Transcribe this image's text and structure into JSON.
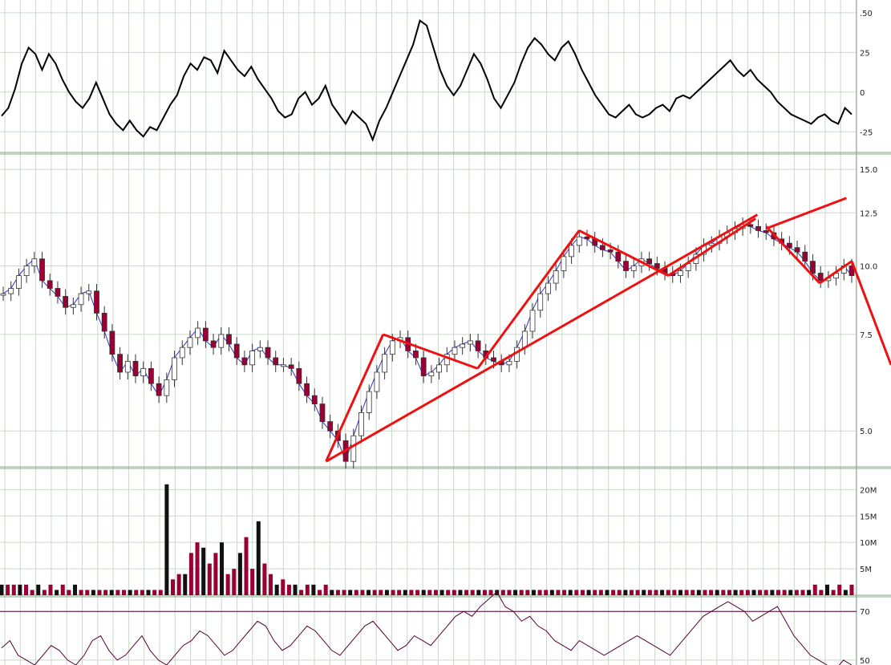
{
  "chart_data": {
    "type": "line",
    "title": "",
    "colors": {
      "background": "#ffffff",
      "grid": "#c9d8c9",
      "panel_border": "#8aa58a",
      "price_up": "#ffffff",
      "price_down": "#990033",
      "trendline": "#ee1111",
      "oscillator": "#000000",
      "rsi_line": "#550033",
      "rsi_fill": "#c8c898"
    },
    "panels": [
      {
        "id": "oscillator",
        "axis_ticks": [
          ".50",
          "25",
          "0",
          "-25"
        ],
        "tick_values": [
          50,
          25,
          0,
          -25
        ],
        "ylim": [
          -38,
          58
        ]
      },
      {
        "id": "price",
        "scale": "log",
        "axis_ticks": [
          "15.0",
          "12.5",
          "10.0",
          "7.5",
          "5.0"
        ],
        "tick_values": [
          15.0,
          12.5,
          10.0,
          7.5,
          5.0
        ],
        "ylim": [
          4.3,
          16.0
        ]
      },
      {
        "id": "volume",
        "axis_ticks": [
          "20M",
          "15M",
          "10M",
          "5M"
        ],
        "tick_values": [
          20,
          15,
          10,
          5
        ],
        "ylim": [
          0,
          24
        ]
      },
      {
        "id": "rsi",
        "axis_ticks": [
          "70",
          "50"
        ],
        "tick_values": [
          70,
          50
        ],
        "ylim": [
          48,
          76
        ]
      }
    ],
    "oscillator_values": [
      -15,
      -10,
      2,
      18,
      28,
      24,
      14,
      24,
      18,
      8,
      0,
      -6,
      -10,
      -4,
      6,
      -4,
      -14,
      -20,
      -24,
      -18,
      -24,
      -28,
      -22,
      -24,
      -16,
      -8,
      -2,
      10,
      18,
      14,
      22,
      20,
      12,
      26,
      20,
      14,
      10,
      16,
      8,
      2,
      -4,
      -12,
      -16,
      -14,
      -4,
      0,
      -8,
      -4,
      4,
      -8,
      -14,
      -20,
      -12,
      -16,
      -20,
      -30,
      -18,
      -10,
      0,
      10,
      20,
      30,
      45,
      42,
      28,
      14,
      4,
      -2,
      4,
      14,
      24,
      18,
      8,
      -4,
      -10,
      -2,
      6,
      18,
      28,
      34,
      30,
      24,
      20,
      28,
      32,
      24,
      14,
      6,
      -2,
      -8,
      -14,
      -16,
      -12,
      -8,
      -14,
      -16,
      -14,
      -10,
      -8,
      -12,
      -4,
      -2,
      -4,
      0,
      4,
      8,
      12,
      16,
      20,
      14,
      10,
      14,
      8,
      4,
      0,
      -6,
      -10,
      -14,
      -16,
      -18,
      -20,
      -16,
      -14,
      -18,
      -20,
      -10,
      -14
    ],
    "price": {
      "closes": [
        8.9,
        9.1,
        9.6,
        10.0,
        10.3,
        9.4,
        9.1,
        8.8,
        8.4,
        8.5,
        8.9,
        9.0,
        8.2,
        7.6,
        6.9,
        6.4,
        6.7,
        6.3,
        6.5,
        6.1,
        5.8,
        6.2,
        6.8,
        7.1,
        7.4,
        7.7,
        7.3,
        7.1,
        7.5,
        7.2,
        6.8,
        6.6,
        7.0,
        7.1,
        6.8,
        6.6,
        6.6,
        6.5,
        6.1,
        5.8,
        5.6,
        5.2,
        5.0,
        4.8,
        4.4,
        4.9,
        5.4,
        5.9,
        6.4,
        6.9,
        7.3,
        7.4,
        7.0,
        6.8,
        6.3,
        6.4,
        6.6,
        6.9,
        7.1,
        7.2,
        7.3,
        7.0,
        6.8,
        6.7,
        6.6,
        6.7,
        7.1,
        7.6,
        8.3,
        8.9,
        9.3,
        9.8,
        10.4,
        10.9,
        11.3,
        11.2,
        10.9,
        10.7,
        10.6,
        10.2,
        9.8,
        10.0,
        10.3,
        10.1,
        9.9,
        9.7,
        9.6,
        9.8,
        10.1,
        10.5,
        10.9,
        11.0,
        11.3,
        11.5,
        11.7,
        11.9,
        11.8,
        11.6,
        11.5,
        11.2,
        11.0,
        10.8,
        10.6,
        10.2,
        9.7,
        9.4,
        9.5,
        9.7,
        10.0,
        9.6
      ],
      "trendlines": [
        {
          "label": "wave-1-up",
          "points": [
            [
              0.366,
              4.4
            ],
            [
              0.43,
              7.5
            ]
          ]
        },
        {
          "label": "wave-2-down",
          "points": [
            [
              0.43,
              7.5
            ],
            [
              0.536,
              6.5
            ]
          ]
        },
        {
          "label": "wave-3-up",
          "points": [
            [
              0.536,
              6.5
            ],
            [
              0.65,
              11.6
            ]
          ]
        },
        {
          "label": "wave-4-down",
          "points": [
            [
              0.65,
              11.6
            ],
            [
              0.75,
              9.6
            ]
          ]
        },
        {
          "label": "wave-5-up",
          "points": [
            [
              0.75,
              9.6
            ],
            [
              0.848,
              12.2
            ]
          ]
        },
        {
          "label": "base-trendline",
          "points": [
            [
              0.366,
              4.4
            ],
            [
              0.85,
              12.4
            ]
          ]
        },
        {
          "label": "upper-channel",
          "points": [
            [
              0.86,
              11.7
            ],
            [
              0.95,
              13.3
            ]
          ]
        },
        {
          "label": "drop-a",
          "points": [
            [
              0.86,
              11.8
            ],
            [
              0.92,
              9.3
            ]
          ]
        },
        {
          "label": "drop-b",
          "points": [
            [
              0.92,
              9.3
            ],
            [
              0.956,
              10.2
            ]
          ]
        },
        {
          "label": "drop-c",
          "points": [
            [
              0.956,
              10.2
            ],
            [
              1.0,
              6.6
            ]
          ]
        }
      ]
    },
    "volume_values": [
      2,
      2,
      2,
      2,
      2,
      1,
      2,
      1,
      2,
      1,
      2,
      1,
      2,
      1,
      1,
      1,
      1,
      1,
      1,
      1,
      1,
      1,
      1,
      1,
      1,
      1,
      1,
      21,
      3,
      4,
      4,
      8,
      10,
      9,
      6,
      8,
      10,
      4,
      5,
      8,
      11,
      5,
      14,
      6,
      4,
      2,
      3,
      2,
      2,
      1,
      2,
      2,
      1,
      2,
      1,
      1,
      1,
      1,
      1,
      1,
      1,
      1,
      1,
      1,
      1,
      1,
      1,
      1,
      1,
      1,
      1,
      1,
      1,
      1,
      1,
      1,
      1,
      1,
      1,
      1,
      1,
      1,
      1,
      1,
      1,
      1,
      1,
      1,
      1,
      1,
      1,
      1,
      1,
      1,
      1,
      1,
      1,
      1,
      1,
      1,
      1,
      1,
      1,
      1,
      1,
      1,
      1,
      1,
      1,
      1,
      1,
      1,
      1,
      1,
      1,
      1,
      1,
      1,
      1,
      1,
      1,
      1,
      1,
      1,
      1,
      1,
      1,
      1,
      1,
      1,
      1,
      1,
      1,
      2,
      1,
      2,
      1,
      2,
      1,
      2
    ],
    "rsi_values": [
      55,
      58,
      52,
      50,
      48,
      52,
      56,
      54,
      50,
      48,
      52,
      58,
      60,
      54,
      50,
      52,
      56,
      60,
      54,
      50,
      48,
      52,
      56,
      58,
      62,
      60,
      56,
      52,
      54,
      58,
      62,
      66,
      64,
      58,
      54,
      56,
      60,
      64,
      62,
      58,
      54,
      52,
      56,
      60,
      64,
      66,
      62,
      58,
      54,
      56,
      60,
      58,
      56,
      60,
      64,
      68,
      70,
      68,
      72,
      75,
      78,
      72,
      70,
      66,
      68,
      64,
      62,
      58,
      56,
      54,
      58,
      56,
      54,
      52,
      54,
      56,
      58,
      60,
      58,
      56,
      54,
      52,
      56,
      60,
      64,
      68,
      70,
      72,
      74,
      72,
      70,
      66,
      68,
      70,
      72,
      66,
      60,
      56,
      52,
      50,
      48,
      46,
      50,
      48
    ]
  }
}
